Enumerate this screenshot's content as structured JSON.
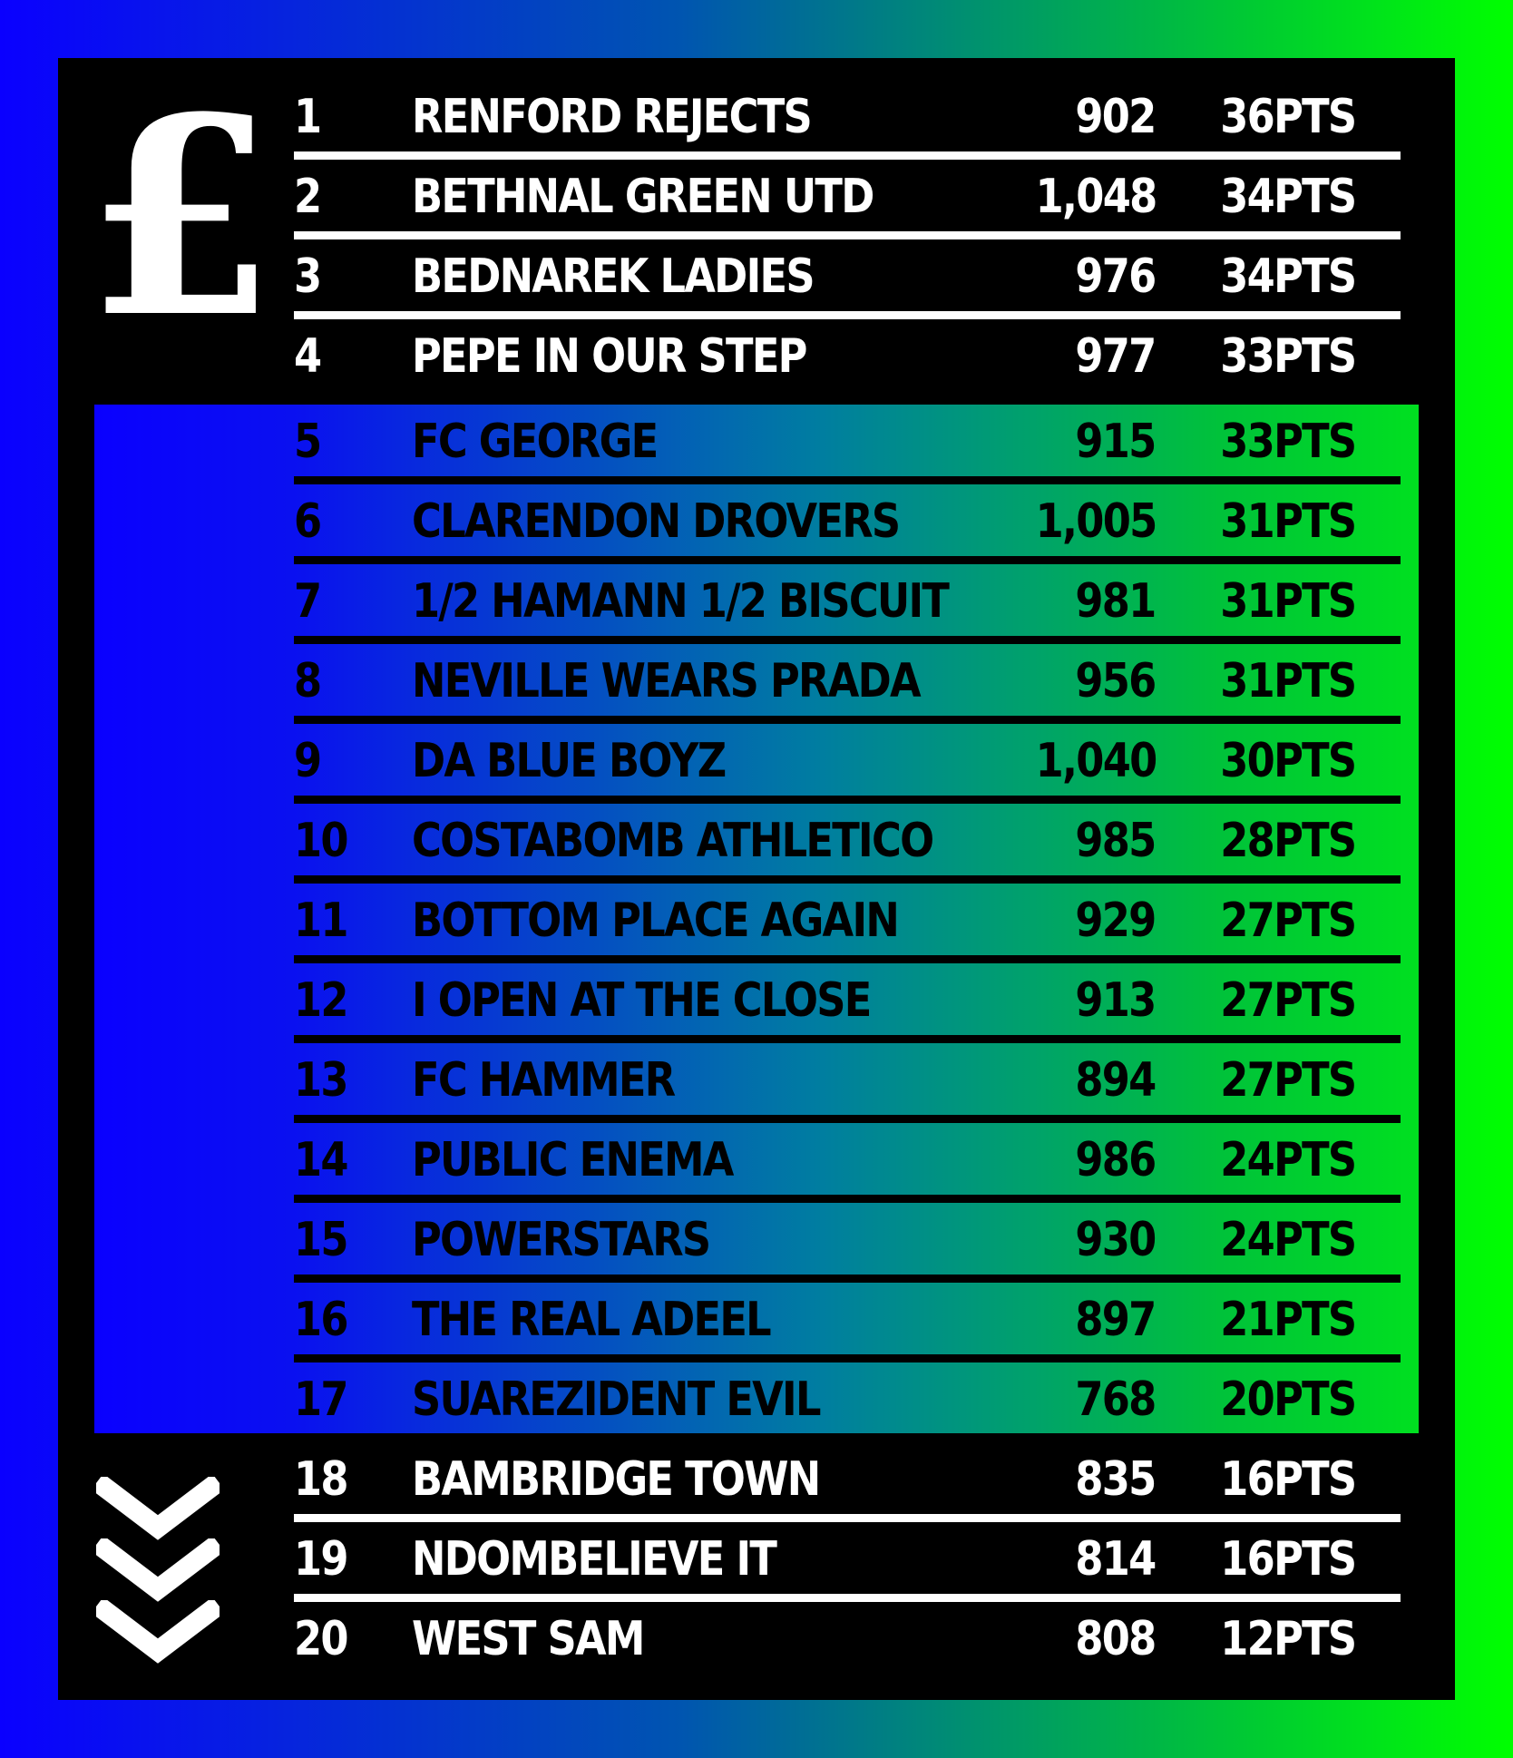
{
  "promotion_icon": "pound-sign-icon",
  "promotion_symbol": "£",
  "relegation_icon": "triple-chevron-down-icon",
  "colors": {
    "panel": "#000000",
    "gradient_start": "#0a00ff",
    "gradient_end": "#00ff00",
    "text_light": "#ffffff",
    "text_dark": "#000000"
  },
  "table": {
    "columns": [
      "position",
      "team",
      "goals",
      "points"
    ],
    "rows": [
      {
        "pos": "1",
        "team": "RENFORD REJECTS",
        "gf": "902",
        "pts": "36PTS"
      },
      {
        "pos": "2",
        "team": "BETHNAL GREEN UTD",
        "gf": "1,048",
        "pts": "34PTS"
      },
      {
        "pos": "3",
        "team": "BEDNAREK LADIES",
        "gf": "976",
        "pts": "34PTS"
      },
      {
        "pos": "4",
        "team": "PEPE IN OUR STEP",
        "gf": "977",
        "pts": "33PTS"
      },
      {
        "pos": "5",
        "team": "FC GEORGE",
        "gf": "915",
        "pts": "33PTS"
      },
      {
        "pos": "6",
        "team": "CLARENDON DROVERS",
        "gf": "1,005",
        "pts": "31PTS"
      },
      {
        "pos": "7",
        "team": "1/2 HAMANN 1/2 BISCUIT",
        "gf": "981",
        "pts": "31PTS"
      },
      {
        "pos": "8",
        "team": "NEVILLE WEARS PRADA",
        "gf": "956",
        "pts": "31PTS"
      },
      {
        "pos": "9",
        "team": "DA BLUE BOYZ",
        "gf": "1,040",
        "pts": "30PTS"
      },
      {
        "pos": "10",
        "team": "COSTABOMB ATHLETICO",
        "gf": "985",
        "pts": "28PTS"
      },
      {
        "pos": "11",
        "team": "BOTTOM PLACE AGAIN",
        "gf": "929",
        "pts": "27PTS"
      },
      {
        "pos": "12",
        "team": "I OPEN AT THE CLOSE",
        "gf": "913",
        "pts": "27PTS"
      },
      {
        "pos": "13",
        "team": "FC HAMMER",
        "gf": "894",
        "pts": "27PTS"
      },
      {
        "pos": "14",
        "team": "PUBLIC ENEMA",
        "gf": "986",
        "pts": "24PTS"
      },
      {
        "pos": "15",
        "team": "POWERSTARS",
        "gf": "930",
        "pts": "24PTS"
      },
      {
        "pos": "16",
        "team": "THE REAL ADEEL",
        "gf": "897",
        "pts": "21PTS"
      },
      {
        "pos": "17",
        "team": "SUAREZIDENT EVIL",
        "gf": "768",
        "pts": "20PTS"
      },
      {
        "pos": "18",
        "team": "BAMBRIDGE TOWN",
        "gf": "835",
        "pts": "16PTS"
      },
      {
        "pos": "19",
        "team": "NDOMBELIEVE IT",
        "gf": "814",
        "pts": "16PTS"
      },
      {
        "pos": "20",
        "team": "WEST SAM",
        "gf": "808",
        "pts": "12PTS"
      }
    ]
  }
}
